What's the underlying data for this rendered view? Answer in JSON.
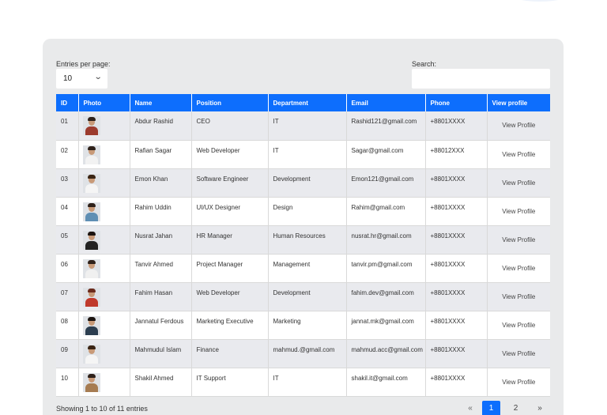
{
  "controls": {
    "entries_label": "Entries per page:",
    "entries_value": "10",
    "search_label": "Search:",
    "search_value": ""
  },
  "table": {
    "columns": [
      "ID",
      "Photo",
      "Name",
      "Position",
      "Department",
      "Email",
      "Phone",
      "View profile"
    ],
    "rows": [
      {
        "id": "01",
        "name": "Abdur Rashid",
        "position": "CEO",
        "department": "IT",
        "email": "Rashid121@gmail.com",
        "phone": "+8801XXXX",
        "action": "View Profile"
      },
      {
        "id": "02",
        "name": "Rafian Sagar",
        "position": "Web Developer",
        "department": "IT",
        "email": "Sagar@gmail.com",
        "phone": "+88012XXX",
        "action": "View Profile"
      },
      {
        "id": "03",
        "name": "Emon Khan",
        "position": "Software Engineer",
        "department": "Development",
        "email": "Emon121@gmail.com",
        "phone": "+8801XXXX",
        "action": "View Profile"
      },
      {
        "id": "04",
        "name": "Rahim Uddin",
        "position": "UI/UX Designer",
        "department": "Design",
        "email": "Rahim@gmail.com",
        "phone": "+8801XXXX",
        "action": "View Profile"
      },
      {
        "id": "05",
        "name": "Nusrat Jahan",
        "position": "HR Manager",
        "department": "Human Resources",
        "email": "nusrat.hr@gmail.com",
        "phone": "+8801XXXX",
        "action": "View Profile"
      },
      {
        "id": "06",
        "name": "Tanvir Ahmed",
        "position": "Project Manager",
        "department": "Management",
        "email": "tanvir.pm@gmail.com",
        "phone": "+8801XXXX",
        "action": "View Profile"
      },
      {
        "id": "07",
        "name": "Fahim Hasan",
        "position": "Web Developer",
        "department": "Development",
        "email": "fahim.dev@gmail.com",
        "phone": "+8801XXXX",
        "action": "View Profile"
      },
      {
        "id": "08",
        "name": "Jannatul Ferdous",
        "position": "Marketing Executive",
        "department": "Marketing",
        "email": "jannat.mk@gmail.com",
        "phone": "+8801XXXX",
        "action": "View Profile"
      },
      {
        "id": "09",
        "name": "Mahmudul Islam",
        "position": "Finance",
        "department": "mahmud.@gmail.com",
        "email": "mahmud.acc@gmail.com",
        "phone": "+8801XXXX",
        "action": "View Profile"
      },
      {
        "id": "10",
        "name": "Shakil Ahmed",
        "position": "IT Support",
        "department": "IT",
        "email": "shakil.it@gmail.com",
        "phone": "+8801XXXX",
        "action": "View Profile"
      }
    ]
  },
  "footer": {
    "info": "Showing 1 to 10 of 11 entries",
    "prev": "«",
    "pages": [
      "1",
      "2"
    ],
    "next": "»"
  },
  "colors": {
    "accent": "#0d6efd",
    "panel": "#e9eaeb",
    "row_alt": "#e9eaee"
  },
  "avatars": [
    {
      "shirt": "#9c3b2e",
      "hair": "#2e211a"
    },
    {
      "shirt": "#f2f2f2",
      "hair": "#2e211a"
    },
    {
      "shirt": "#f5f5f5",
      "hair": "#3a2414"
    },
    {
      "shirt": "#5f8fb4",
      "hair": "#2e211a"
    },
    {
      "shirt": "#222222",
      "hair": "#1c1410"
    },
    {
      "shirt": "#f0f0f0",
      "hair": "#2e211a"
    },
    {
      "shirt": "#c0392b",
      "hair": "#6b2b1c"
    },
    {
      "shirt": "#2c3e50",
      "hair": "#1c1410"
    },
    {
      "shirt": "#f5f5f5",
      "hair": "#3a2414"
    },
    {
      "shirt": "#a67c52",
      "hair": "#2e211a"
    }
  ]
}
